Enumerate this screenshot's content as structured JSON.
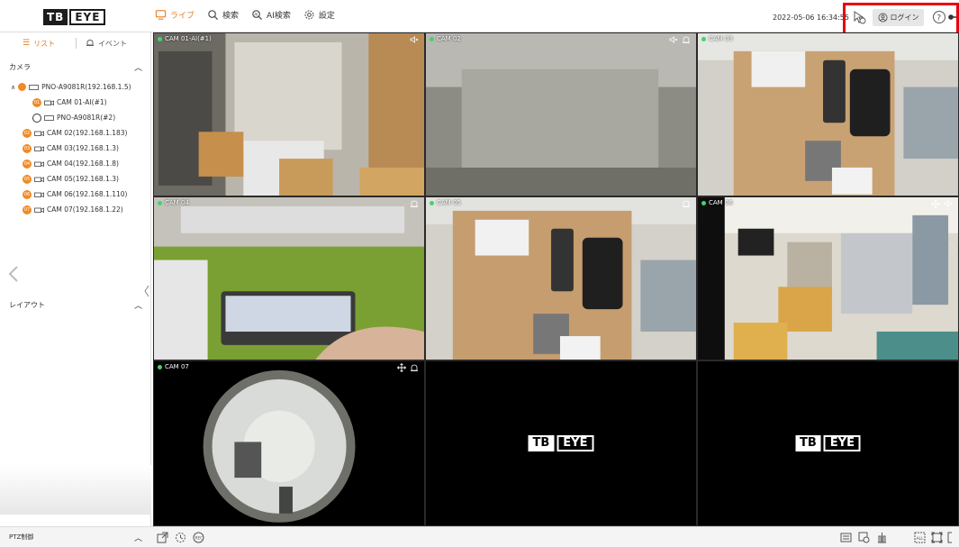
{
  "header": {
    "logo_left": "TB",
    "logo_right": "EYE",
    "nav": [
      {
        "label": "ライブ",
        "icon": "monitor-icon",
        "active": true
      },
      {
        "label": "検索",
        "icon": "search-icon"
      },
      {
        "label": "AI検索",
        "icon": "ai-search-icon"
      },
      {
        "label": "設定",
        "icon": "gear-icon"
      }
    ],
    "datetime": "2022-05-06 16:34:55",
    "login_label": "ログイン",
    "accent_color": "#e57c1f",
    "highlight_color": "#e8000f"
  },
  "sidebar": {
    "tab_list": "リスト",
    "tab_event": "イベント",
    "camera_section": "カメラ",
    "layout_section": "レイアウト",
    "ptz_label": "PTZ制御",
    "tree": [
      {
        "label": "PNO-A9081R(192.168.1.5)",
        "badge": "",
        "level": 0
      },
      {
        "label": "CAM 01-AI(#1)",
        "badge": "01",
        "level": 1
      },
      {
        "label": "PNO-A9081R(#2)",
        "badge": "",
        "level": 1
      },
      {
        "label": "CAM 02(192.168.1.183)",
        "badge": "02",
        "level": 0
      },
      {
        "label": "CAM 03(192.168.1.3)",
        "badge": "03",
        "level": 0
      },
      {
        "label": "CAM 04(192.168.1.8)",
        "badge": "04",
        "level": 0
      },
      {
        "label": "CAM 05(192.168.1.3)",
        "badge": "05",
        "level": 0
      },
      {
        "label": "CAM 06(192.168.1.110)",
        "badge": "06",
        "level": 0
      },
      {
        "label": "CAM 07(192.168.1.22)",
        "badge": "07",
        "level": 0
      }
    ]
  },
  "grid": {
    "cells": [
      {
        "label": "CAM 01-AI(#1)",
        "status_color": "#3fd66a",
        "scene": "office-shelves"
      },
      {
        "label": "CAM 02",
        "status_color": "#3fd66a",
        "scene": "blurred-white"
      },
      {
        "label": "CAM 03",
        "status_color": "#3fd66a",
        "scene": "access-panel"
      },
      {
        "label": "CAM 04",
        "status_color": "#3fd66a",
        "scene": "desk-closeup"
      },
      {
        "label": "CAM 05",
        "status_color": "#3fd66a",
        "scene": "access-panel"
      },
      {
        "label": "CAM 06",
        "status_color": "#3fd66a",
        "scene": "office-wide"
      },
      {
        "label": "CAM 07",
        "status_color": "#3fd66a",
        "scene": "fisheye"
      },
      {
        "label": "",
        "scene": "empty"
      },
      {
        "label": "",
        "scene": "empty"
      }
    ],
    "empty_logo_left": "TB",
    "empty_logo_right": "EYE"
  }
}
